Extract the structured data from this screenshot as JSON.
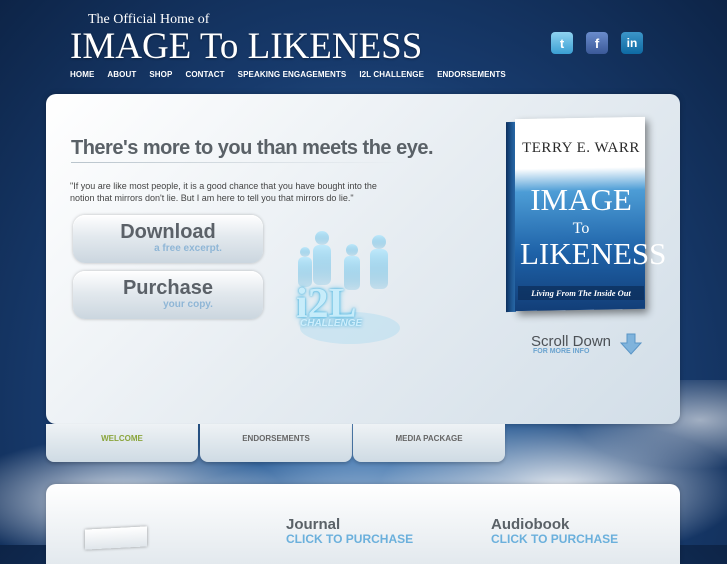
{
  "header": {
    "tagline": "The Official Home of",
    "site_title": "IMAGE To LIKENESS"
  },
  "social": [
    {
      "name": "twitter-icon",
      "glyph": "t"
    },
    {
      "name": "facebook-icon",
      "glyph": "f"
    },
    {
      "name": "linkedin-icon",
      "glyph": "in"
    }
  ],
  "nav": {
    "items": [
      "HOME",
      "ABOUT",
      "SHOP",
      "CONTACT",
      "SPEAKING ENGAGEMENTS",
      "I2L CHALLENGE",
      "ENDORSEMENTS"
    ]
  },
  "hero": {
    "headline": "There's more to you than meets the eye.",
    "quote": "\"If you are like most people, it is a good chance that you have bought into the notion that mirrors don't lie. But I am here to tell you that mirrors do lie.\"",
    "download": {
      "label": "Download",
      "sub": "a free excerpt."
    },
    "purchase": {
      "label": "Purchase",
      "sub": "your copy."
    },
    "logo": {
      "text": "i2L",
      "sub": "CHALLENGE"
    },
    "book": {
      "author": "TERRY E. WARR",
      "title_line1": "IMAGE",
      "title_line2": "To",
      "title_line3": "LIKENESS",
      "subtitle": "Living From The Inside Out"
    },
    "scroll": {
      "label": "Scroll Down",
      "sub": "FOR MORE INFO"
    }
  },
  "tabs": [
    "WELCOME",
    "ENDORSEMENTS",
    "MEDIA PACKAGE"
  ],
  "products": [
    {
      "title": "Journal",
      "link": "CLICK TO PURCHASE"
    },
    {
      "title": "Audiobook",
      "link": "CLICK TO PURCHASE"
    }
  ],
  "colors": {
    "accent_blue": "#6bb0dc",
    "active_tab": "#8aa53c",
    "background": "#173a6c"
  }
}
